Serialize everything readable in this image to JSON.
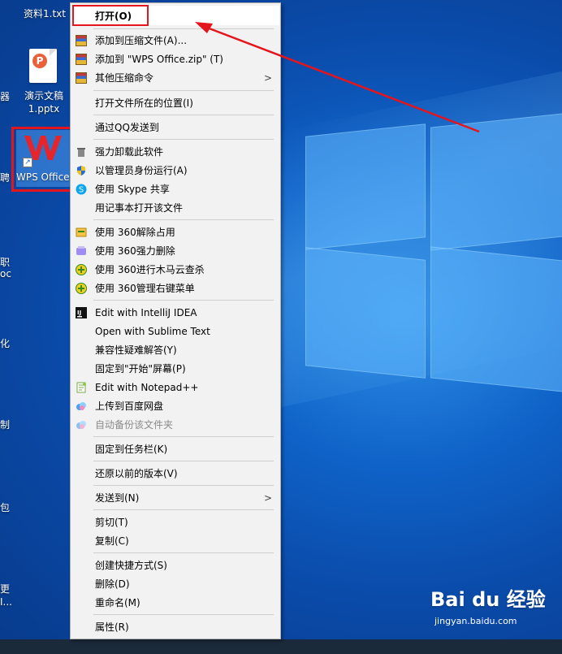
{
  "desktop": {
    "file_txt_label": "资料1.txt",
    "pptx_label_line1": "演示文稿",
    "pptx_label_line2": "1.pptx",
    "ppt_icon_letter": "P",
    "wps_label": "WPS Office",
    "edge_fragments": [
      "器",
      "聘",
      "职",
      "oc",
      "化",
      "制",
      "包",
      "更",
      "I..."
    ]
  },
  "context_menu": {
    "items": [
      {
        "label": "打开(O)",
        "icon": "none",
        "bold": true
      },
      {
        "label": "添加到压缩文件(A)...",
        "icon": "winrar-icon"
      },
      {
        "label": "添加到 \"WPS Office.zip\" (T)",
        "icon": "winrar-icon"
      },
      {
        "label": "其他压缩命令",
        "icon": "winrar-icon",
        "submenu": ">"
      },
      {
        "label": "打开文件所在的位置(I)"
      },
      {
        "label": "通过QQ发送到"
      },
      {
        "label": "强力卸载此软件",
        "icon": "trash-icon"
      },
      {
        "label": "以管理员身份运行(A)",
        "icon": "shield-icon"
      },
      {
        "label": "使用 Skype 共享",
        "icon": "skype-icon"
      },
      {
        "label": "用记事本打开该文件"
      },
      {
        "label": "使用 360解除占用",
        "icon": "360-unlock-icon"
      },
      {
        "label": "使用 360强力删除",
        "icon": "360-delete-icon"
      },
      {
        "label": "使用 360进行木马云查杀",
        "icon": "360-scan-icon"
      },
      {
        "label": "使用 360管理右键菜单",
        "icon": "360-menu-icon"
      },
      {
        "label": "Edit with IntelliJ IDEA",
        "icon": "intellij-icon"
      },
      {
        "label": "Open with Sublime Text"
      },
      {
        "label": "兼容性疑难解答(Y)"
      },
      {
        "label": "固定到\"开始\"屏幕(P)"
      },
      {
        "label": "Edit with Notepad++",
        "icon": "notepadpp-icon"
      },
      {
        "label": "上传到百度网盘",
        "icon": "baidu-netdisk-icon"
      },
      {
        "label": "自动备份该文件夹",
        "icon": "baidu-netdisk-icon",
        "disabled": true
      },
      {
        "label": "固定到任务栏(K)"
      },
      {
        "label": "还原以前的版本(V)"
      },
      {
        "label": "发送到(N)",
        "submenu": ">"
      },
      {
        "label": "剪切(T)"
      },
      {
        "label": "复制(C)"
      },
      {
        "label": "创建快捷方式(S)"
      },
      {
        "label": "删除(D)"
      },
      {
        "label": "重命名(M)"
      },
      {
        "label": "属性(R)"
      }
    ]
  },
  "watermark": {
    "brand": "Bai du 经验",
    "url": "jingyan.baidu.com"
  },
  "colors": {
    "annotation_red": "#e4151c",
    "desktop_blue": "#0f62c8",
    "menu_bg": "#f2f2f2"
  }
}
